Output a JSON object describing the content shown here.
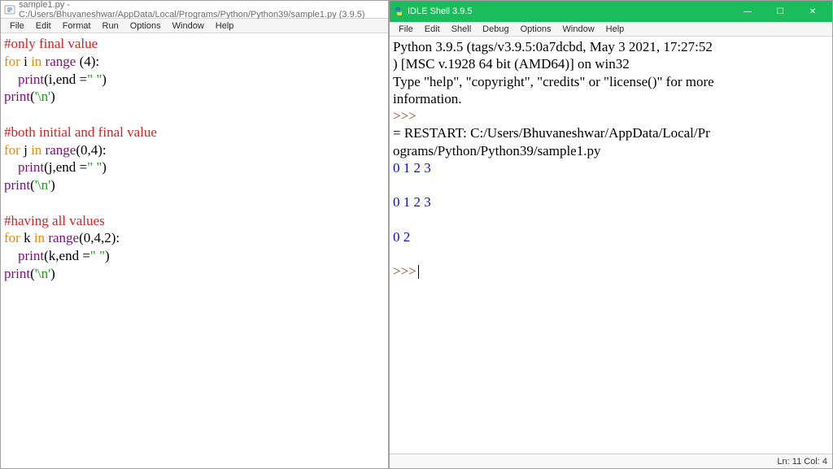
{
  "editor_window": {
    "title": "sample1.py - C:/Users/Bhuvaneshwar/AppData/Local/Programs/Python/Python39/sample1.py (3.9.5)",
    "menus": [
      "File",
      "Edit",
      "Format",
      "Run",
      "Options",
      "Window",
      "Help"
    ],
    "code": {
      "c1": "#only final value",
      "l2a": "for",
      "l2b": " i ",
      "l2c": "in",
      "l2d": " ",
      "l2e": "range",
      "l2f": " (4):",
      "l3a": "    ",
      "l3b": "print",
      "l3c": "(i,end =",
      "l3d": "\" \"",
      "l3e": ")",
      "l4a": "print",
      "l4b": "(",
      "l4c": "'\\n'",
      "l4d": ")",
      "c2": "#both initial and final value",
      "l6a": "for",
      "l6b": " j ",
      "l6c": "in",
      "l6d": " ",
      "l6e": "range",
      "l6f": "(0,4):",
      "l7a": "    ",
      "l7b": "print",
      "l7c": "(j,end =",
      "l7d": "\" \"",
      "l7e": ")",
      "l8a": "print",
      "l8b": "(",
      "l8c": "'\\n'",
      "l8d": ")",
      "c3": "#having all values",
      "l10a": "for",
      "l10b": " k ",
      "l10c": "in",
      "l10d": " ",
      "l10e": "range",
      "l10f": "(0,4,2):",
      "l11a": "    ",
      "l11b": "print",
      "l11c": "(k,end =",
      "l11d": "\" \"",
      "l11e": ")",
      "l12a": "print",
      "l12b": "(",
      "l12c": "'\\n'",
      "l12d": ")"
    }
  },
  "shell_window": {
    "title": "IDLE Shell 3.9.5",
    "menus": [
      "File",
      "Edit",
      "Shell",
      "Debug",
      "Options",
      "Window",
      "Help"
    ],
    "controls": {
      "min": "—",
      "max": "☐",
      "close": "✕"
    },
    "banner1": "Python 3.9.5 (tags/v3.9.5:0a7dcbd, May  3 2021, 17:27:52",
    "banner2": ") [MSC v.1928 64 bit (AMD64)] on win32",
    "banner3": "Type \"help\", \"copyright\", \"credits\" or \"license()\" for more",
    "banner4": "information.",
    "prompt": ">>>",
    "restart1": "= RESTART: C:/Users/Bhuvaneshwar/AppData/Local/Pr",
    "restart2": "ograms/Python/Python39/sample1.py",
    "out1": "0 1 2 3 ",
    "out2": "0 1 2 3 ",
    "out3": "0 2 ",
    "status": "Ln: 11   Col: 4"
  }
}
